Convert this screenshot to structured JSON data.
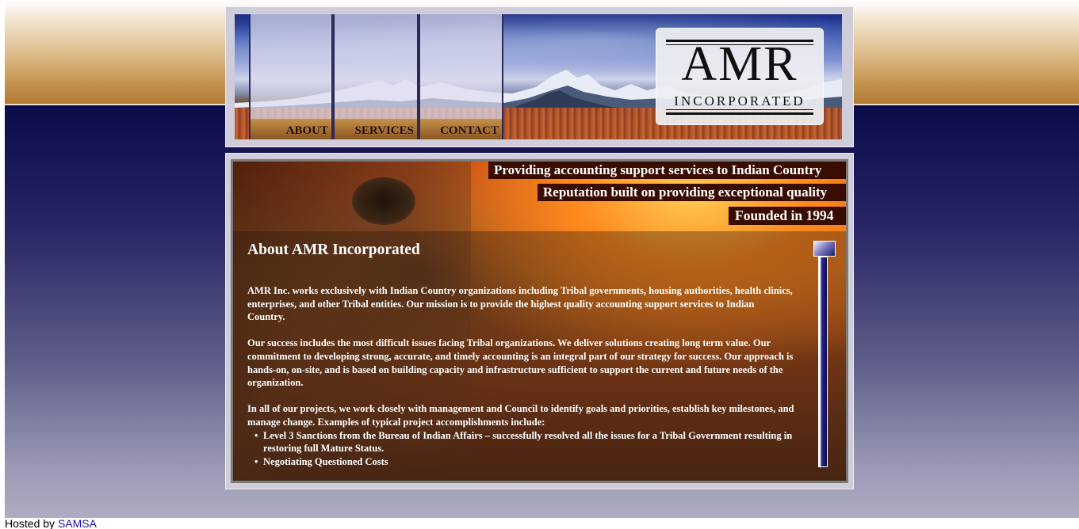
{
  "nav": {
    "items": [
      {
        "label": "ABOUT"
      },
      {
        "label": "SERVICES"
      },
      {
        "label": "CONTACT"
      }
    ]
  },
  "logo": {
    "main": "AMR",
    "sub": "INCORPORATED"
  },
  "taglines": [
    "Providing accounting support services to Indian Country",
    "Reputation built on providing exceptional quality",
    "Founded in 1994"
  ],
  "article": {
    "title": "About AMR Incorporated",
    "paragraphs": [
      "AMR Inc. works exclusively with Indian Country organizations including Tribal governments, housing authorities, health clinics, enterprises, and other Tribal entities. Our mission is to provide the highest quality accounting support services to Indian Country.",
      "Our success includes the most difficult issues facing Tribal organizations.  We deliver solutions creating long term value.  Our commitment to developing strong, accurate, and timely accounting is an integral part of our strategy for success.  Our approach is hands-on, on-site, and is based on building capacity and infrastructure sufficient to support the current and future needs of the organization.",
      "In all of our projects, we work closely with management and Council to identify goals and priorities, establish key milestones, and manage change.  Examples of typical project accomplishments include:"
    ],
    "bullets": [
      "Level 3 Sanctions from the Bureau of Indian Affairs – successfully resolved all the issues for a Tribal Government resulting in restoring full Mature Status.",
      "Negotiating Questioned Costs"
    ]
  },
  "footer": {
    "prefix": "Hosted by ",
    "link": "SAMSA"
  },
  "colors": {
    "page_gradient_top": "#05003a",
    "page_gradient_bottom": "#aeadc3",
    "band_top": "#dfbf8f",
    "band_bottom": "#b17a34",
    "tagline_bg": "#3a0c00",
    "scrollbar": "#1a1a70",
    "link": "#1a0dab"
  },
  "icons": {
    "scroll_thumb": "scroll-thumb-icon"
  }
}
